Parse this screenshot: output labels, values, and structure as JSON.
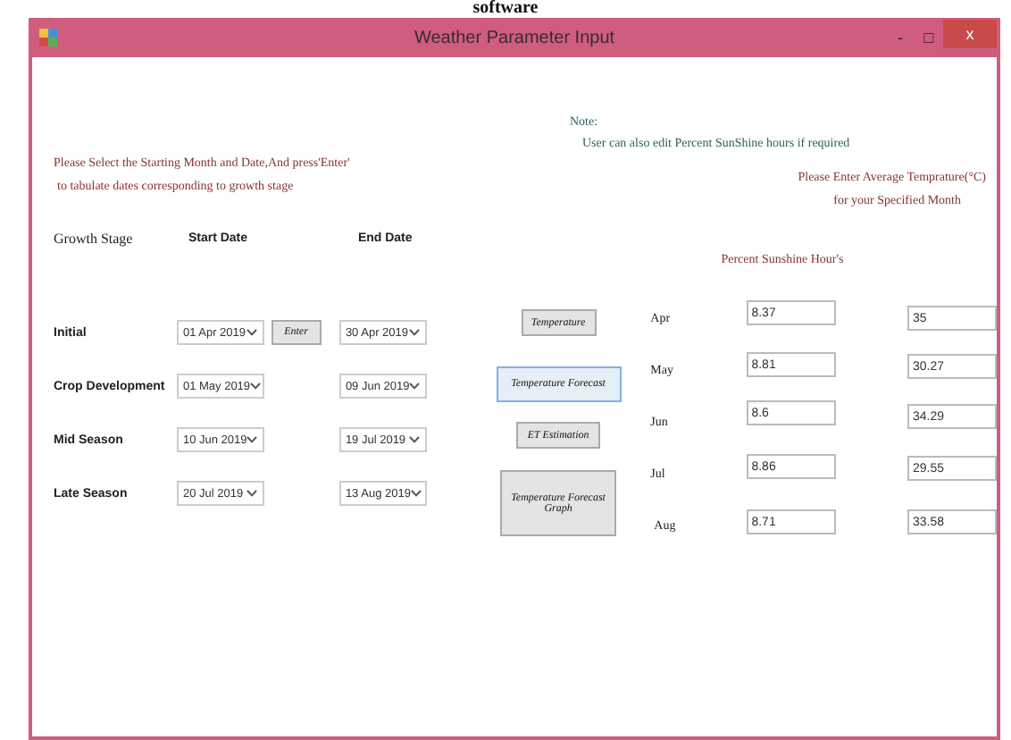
{
  "caption": "software",
  "window": {
    "title": "Weather Parameter Input",
    "buttons": [
      "-",
      "□",
      "x"
    ]
  },
  "instructions": [
    "Please Select the Starting Month and Date,And press'Enter'",
    "to tabulate dates corresponding to growth stage"
  ],
  "note": {
    "heading": "Note:",
    "text": "User can also edit Percent SunShine hours if required"
  },
  "temperature_prompt": [
    "Please Enter Average Temprature(°C)",
    "for your Specified Month"
  ],
  "columns": [
    "Growth Stage",
    "Start Date",
    "End Date"
  ],
  "stages": [
    {
      "name": "Initial",
      "start": "01 Apr 2019",
      "end": "30 Apr 2019"
    },
    {
      "name": "Crop Development",
      "start": "01 May 2019",
      "end": "09 Jun 2019"
    },
    {
      "name": "Mid Season",
      "start": "10 Jun 2019",
      "end": "19 Jul 2019"
    },
    {
      "name": "Late Season",
      "start": "20 Jul 2019",
      "end": "13 Aug 2019"
    }
  ],
  "enter_button": "Enter",
  "actions": [
    {
      "label": "Temperature",
      "focused": false
    },
    {
      "label": "Temperature Forecast",
      "focused": true
    },
    {
      "label": "ET Estimation",
      "focused": false
    },
    {
      "label": "Temperature Forecast Graph",
      "focused": false
    }
  ],
  "sunshine_header": "Percent Sunshine Hour's",
  "months": [
    {
      "month": "Apr",
      "sunshine": "8.37",
      "temperature": "35"
    },
    {
      "month": "May",
      "sunshine": "8.81",
      "temperature": "30.27"
    },
    {
      "month": "Jun",
      "sunshine": "8.6",
      "temperature": "34.29"
    },
    {
      "month": "Jul",
      "sunshine": "8.86",
      "temperature": "29.55"
    },
    {
      "month": "Aug",
      "sunshine": "8.71",
      "temperature": "33.58"
    }
  ]
}
